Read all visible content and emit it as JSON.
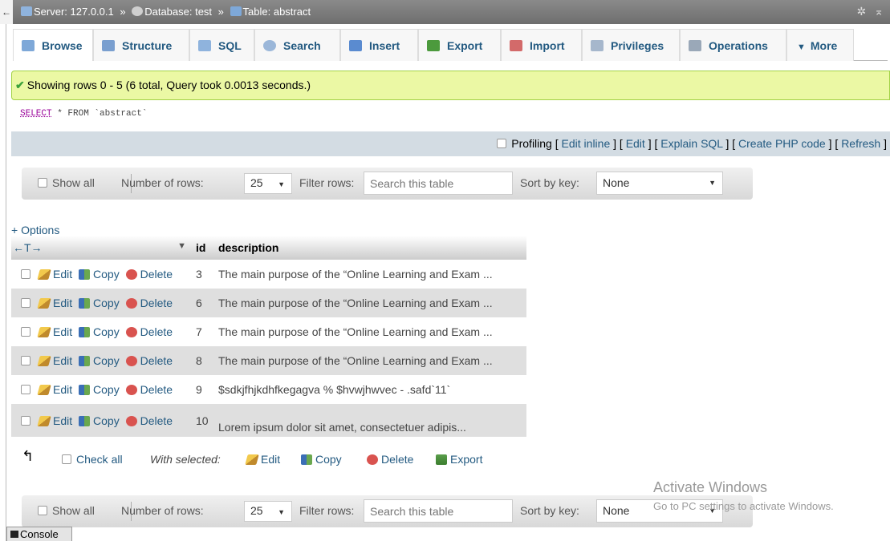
{
  "breadcrumb": {
    "server": "Server: 127.0.0.1",
    "database": "Database: test",
    "table": "Table: abstract",
    "separator": "»"
  },
  "tabs": [
    {
      "label": "Browse",
      "icon": "table-icon",
      "color": "#7ea8d8"
    },
    {
      "label": "Structure",
      "icon": "structure-icon",
      "color": "#7a9fcf"
    },
    {
      "label": "SQL",
      "icon": "sql-icon",
      "color": "#8fb3dd"
    },
    {
      "label": "Search",
      "icon": "search-icon",
      "color": "#9bb7d9"
    },
    {
      "label": "Insert",
      "icon": "insert-icon",
      "color": "#5a8bd0"
    },
    {
      "label": "Export",
      "icon": "export-icon",
      "color": "#4c9a3d"
    },
    {
      "label": "Import",
      "icon": "import-icon",
      "color": "#d36a6a"
    },
    {
      "label": "Privileges",
      "icon": "privileges-icon",
      "color": "#a6b7cc"
    },
    {
      "label": "Operations",
      "icon": "wrench-icon",
      "color": "#9aa8b8"
    },
    {
      "label": "More",
      "icon": "chevron-down-icon",
      "color": "#555555"
    }
  ],
  "message": "Showing rows 0 - 5 (6 total, Query took 0.0013 seconds.)",
  "sql": {
    "keyword": "SELECT",
    "rest": " * FROM `abstract`"
  },
  "profiling": {
    "label": "Profiling",
    "links": [
      "Edit inline",
      "Edit",
      "Explain SQL",
      "Create PHP code",
      "Refresh"
    ]
  },
  "nav": {
    "show_all": "Show all",
    "number_of_rows_label": "Number of rows:",
    "rows_value": "25",
    "filter_label": "Filter rows:",
    "filter_placeholder": "Search this table",
    "sort_label": "Sort by key:",
    "sort_value": "None"
  },
  "options_label": "+ Options",
  "table": {
    "headers": {
      "arrows": "←T→",
      "id": "id",
      "description": "description"
    },
    "actions": {
      "edit": "Edit",
      "copy": "Copy",
      "delete": "Delete"
    },
    "rows": [
      {
        "id": "3",
        "description": "The main purpose of the “Online Learning and Exam ..."
      },
      {
        "id": "6",
        "description": "The main purpose of the “Online Learning and Exam ..."
      },
      {
        "id": "7",
        "description": "The main purpose of the “Online Learning and Exam ..."
      },
      {
        "id": "8",
        "description": "The main purpose of the “Online Learning and Exam ..."
      },
      {
        "id": "9",
        "description": "$sdkjfhjkdhfkegagva % $hvwjhwvec - .safd`11`"
      },
      {
        "id": "10",
        "description": "Lorem ipsum dolor sit amet, consectetuer adipis..."
      }
    ]
  },
  "bulk": {
    "check_all": "Check all",
    "with_selected": "With selected:",
    "edit": "Edit",
    "copy": "Copy",
    "delete": "Delete",
    "export": "Export"
  },
  "watermark": {
    "line1": "Activate Windows",
    "line2": "Go to PC settings to activate Windows."
  },
  "console": "Console"
}
